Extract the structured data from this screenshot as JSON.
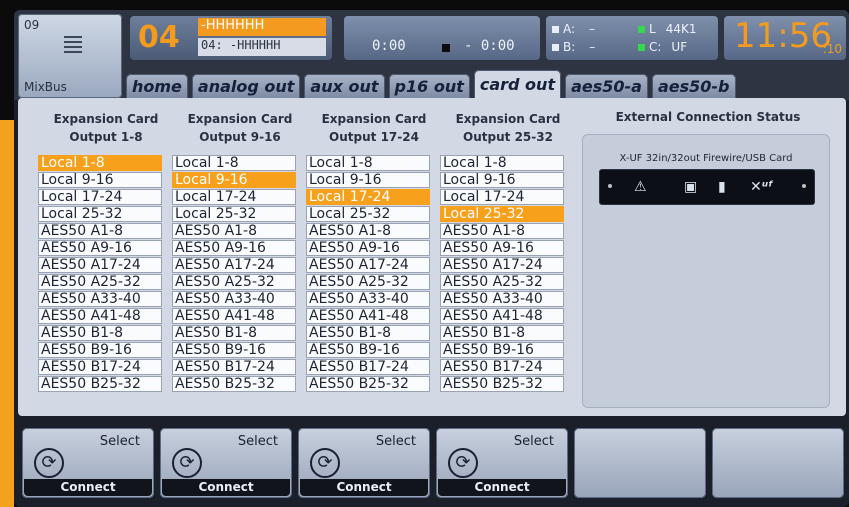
{
  "channel": {
    "number": "09",
    "name": "MixBus"
  },
  "selected": {
    "number": "04",
    "name_primary": "-HHHHHH",
    "name_secondary": "04: -HHHHHH"
  },
  "tape": {
    "time_elapsed": "0:00",
    "time_remaining": "- 0:00"
  },
  "io": {
    "a_label": "A:",
    "a_value": "–",
    "b_label": "B:",
    "b_value": "–",
    "l_label": "L",
    "l_value": "44K1",
    "c_label": "C:",
    "c_value": "UF"
  },
  "clock": {
    "time": "11:56",
    "seconds": ":10"
  },
  "tabs": [
    {
      "label": "home"
    },
    {
      "label": "analog out"
    },
    {
      "label": "aux out"
    },
    {
      "label": "p16 out"
    },
    {
      "label": "card out"
    },
    {
      "label": "aes50-a"
    },
    {
      "label": "aes50-b"
    }
  ],
  "active_tab": "card out",
  "columns": [
    {
      "title_line1": "Expansion Card",
      "title_line2": "Output 1-8",
      "selected_index": 0
    },
    {
      "title_line1": "Expansion Card",
      "title_line2": "Output 9-16",
      "selected_index": 1
    },
    {
      "title_line1": "Expansion Card",
      "title_line2": "Output 17-24",
      "selected_index": 2
    },
    {
      "title_line1": "Expansion Card",
      "title_line2": "Output 25-32",
      "selected_index": 3
    }
  ],
  "sources": [
    "Local 1-8",
    "Local 9-16",
    "Local 17-24",
    "Local 25-32",
    "AES50 A1-8",
    "AES50 A9-16",
    "AES50 A17-24",
    "AES50 A25-32",
    "AES50 A33-40",
    "AES50 A41-48",
    "AES50 B1-8",
    "AES50 B9-16",
    "AES50 B17-24",
    "AES50 B25-32"
  ],
  "status": {
    "title": "External Connection Status",
    "card_title": "X-UF  32in/32out Firewire/USB Card"
  },
  "buttons": [
    {
      "select_label": "Select",
      "connect_label": "Connect"
    },
    {
      "select_label": "Select",
      "connect_label": "Connect"
    },
    {
      "select_label": "Select",
      "connect_label": "Connect"
    },
    {
      "select_label": "Select",
      "connect_label": "Connect"
    },
    {
      "select_label": "",
      "connect_label": ""
    },
    {
      "select_label": "",
      "connect_label": ""
    }
  ],
  "colors": {
    "accent": "#f7a01c",
    "panel": "#d2d9e4",
    "background": "#1a1f29"
  }
}
